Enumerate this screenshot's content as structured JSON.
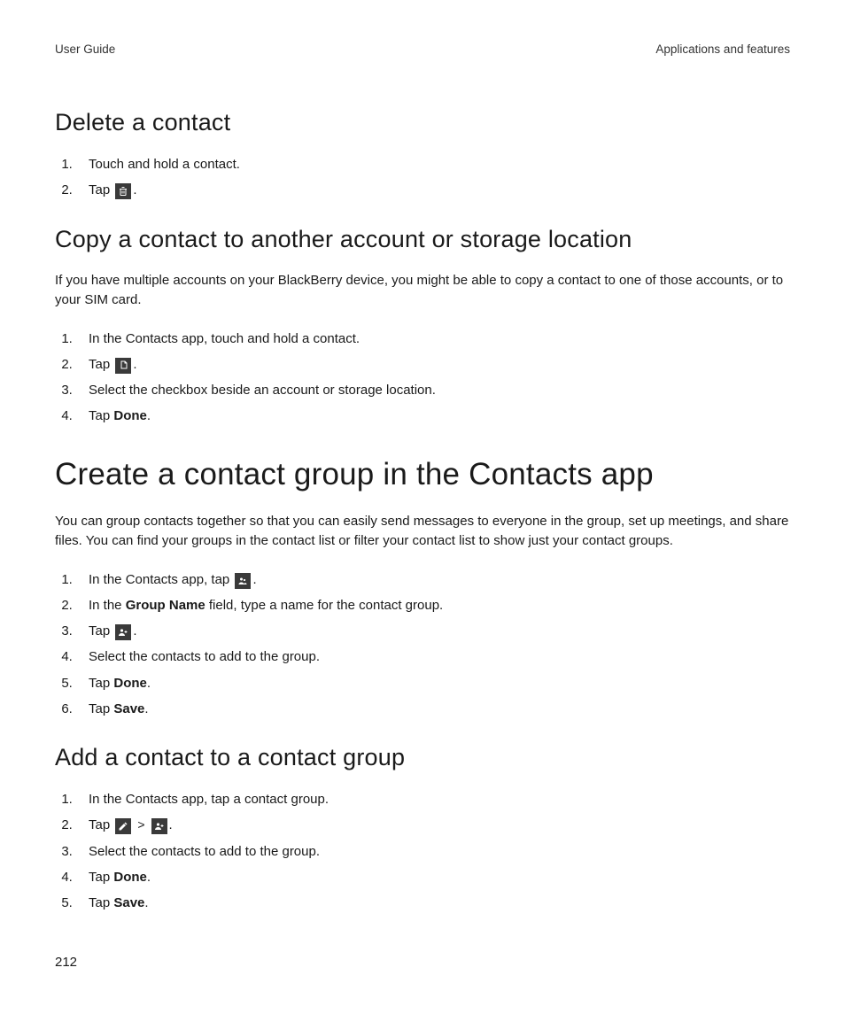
{
  "header": {
    "left": "User Guide",
    "right": "Applications and features"
  },
  "sections": {
    "delete": {
      "heading": "Delete a contact",
      "step1": "Touch and hold a contact.",
      "step2_pre": "Tap ",
      "step2_post": "."
    },
    "copy": {
      "heading": "Copy a contact to another account or storage location",
      "intro": "If you have multiple accounts on your BlackBerry device, you might be able to copy a contact to one of those accounts, or to your SIM card.",
      "step1": "In the Contacts app, touch and hold a contact.",
      "step2_pre": "Tap ",
      "step2_post": ".",
      "step3": "Select the checkbox beside an account or storage location.",
      "step4_pre": "Tap ",
      "step4_bold": "Done",
      "step4_post": "."
    },
    "create": {
      "heading": "Create a contact group in the Contacts app",
      "intro": "You can group contacts together so that you can easily send messages to everyone in the group, set up meetings, and share files. You can find your groups in the contact list or filter your contact list to show just your contact groups.",
      "step1_pre": "In the Contacts app, tap ",
      "step1_post": ".",
      "step2_pre": "In the ",
      "step2_bold": "Group Name",
      "step2_post": " field, type a name for the contact group.",
      "step3_pre": "Tap ",
      "step3_post": ".",
      "step4": "Select the contacts to add to the group.",
      "step5_pre": "Tap ",
      "step5_bold": "Done",
      "step5_post": ".",
      "step6_pre": "Tap ",
      "step6_bold": "Save",
      "step6_post": "."
    },
    "add": {
      "heading": "Add a contact to a contact group",
      "step1": "In the Contacts app, tap a contact group.",
      "step2_pre": "Tap ",
      "step2_gt": ">",
      "step2_post": ".",
      "step3": "Select the contacts to add to the group.",
      "step4_pre": "Tap ",
      "step4_bold": "Done",
      "step4_post": ".",
      "step5_pre": "Tap ",
      "step5_bold": "Save",
      "step5_post": "."
    }
  },
  "page_number": "212"
}
